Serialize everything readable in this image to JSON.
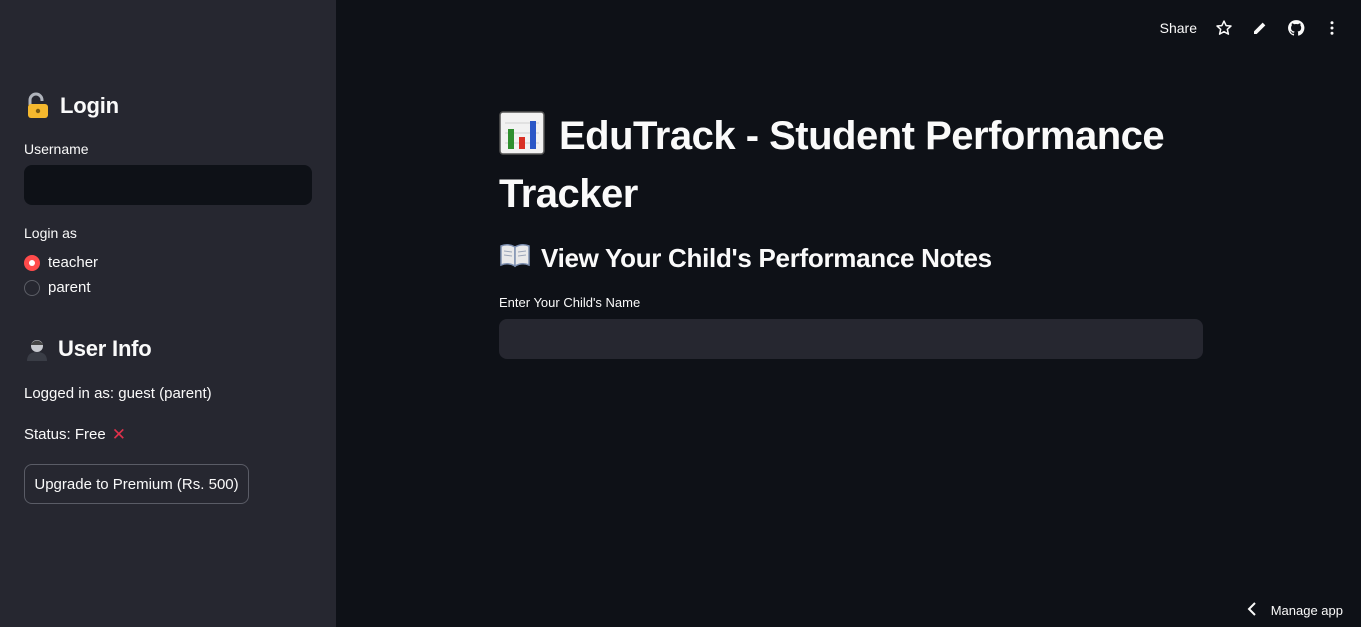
{
  "sidebar": {
    "login_heading": "Login",
    "username_label": "Username",
    "username_value": "",
    "login_as_label": "Login as",
    "roles": [
      {
        "label": "teacher",
        "selected": true
      },
      {
        "label": "parent",
        "selected": false
      }
    ],
    "user_info_heading": "User Info",
    "logged_in_text": "Logged in as: guest (parent)",
    "status_text": "Status: Free",
    "upgrade_button": "Upgrade to Premium (Rs. 500)"
  },
  "toolbar": {
    "share_label": "Share",
    "icons": [
      "star-icon",
      "pencil-icon",
      "github-icon",
      "more-vertical-icon"
    ]
  },
  "main": {
    "title": "EduTrack - Student Performance Tracker",
    "subheading": "View Your Child's Performance Notes",
    "child_name_label": "Enter Your Child's Name",
    "child_name_value": ""
  },
  "footer": {
    "manage_app_label": "Manage app"
  },
  "colors": {
    "background": "#0e1117",
    "sidebar": "#262730",
    "accent": "#ff4b4b",
    "text": "#fafafa"
  }
}
